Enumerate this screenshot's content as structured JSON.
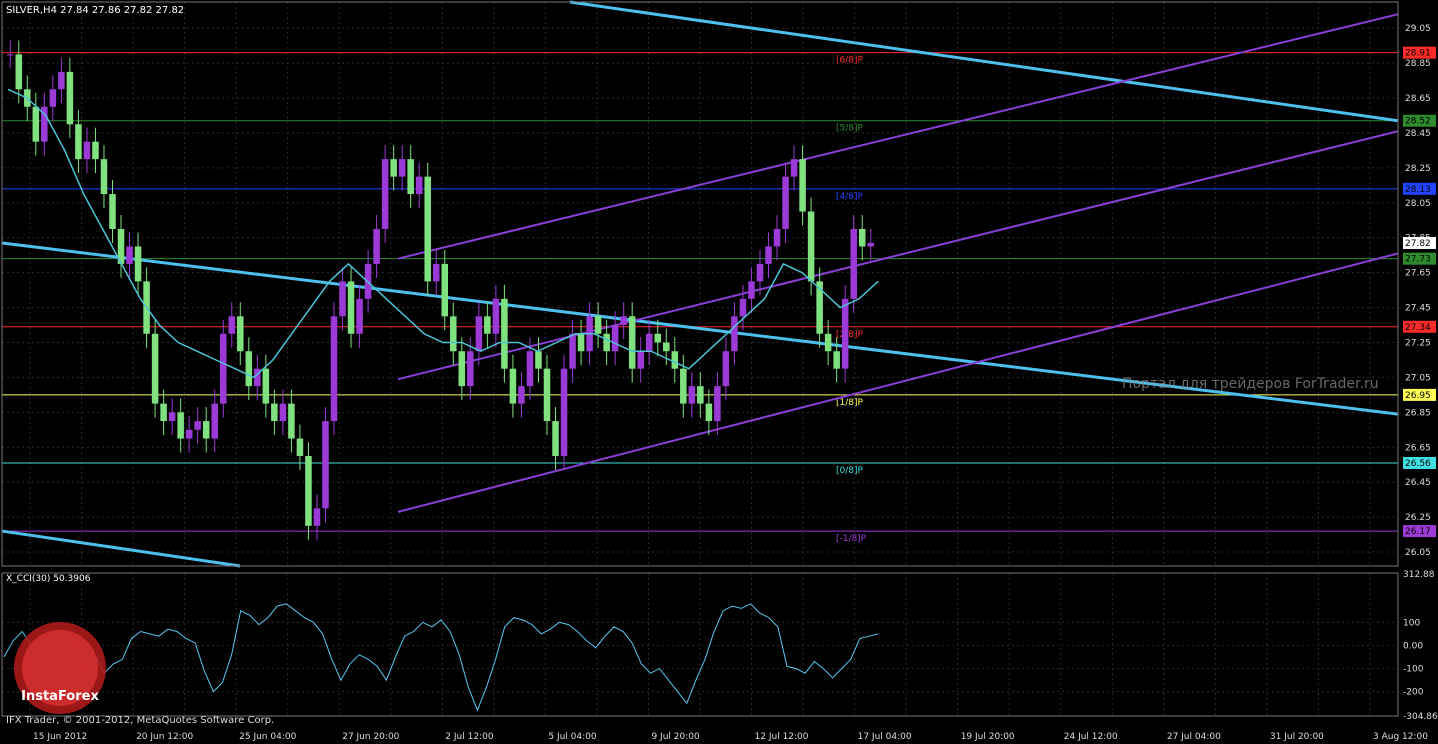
{
  "window": {
    "title": "SILVER,H4  27.84 27.86 27.82 27.82",
    "footer": "IFX Trader, © 2001-2012, MetaQuotes Software Corp.",
    "watermark": "Портал для трейдеров  ForTrader.ru",
    "logo_text": "InstaForex"
  },
  "colors": {
    "background": "#000000",
    "grid": "#2a2a2a",
    "bull": "#9b3ad6",
    "bear": "#7fe27f",
    "ma": "#4bc4d8",
    "trend_cyan": "#4cc0ee",
    "channel": "#8a3fd6",
    "cci": "#59c8f0"
  },
  "chart_data": [
    {
      "type": "candlestick",
      "symbol": "SILVER",
      "timeframe": "H4",
      "ohlc_last": {
        "open": 27.84,
        "high": 27.86,
        "low": 27.82,
        "close": 27.82
      },
      "ylim": [
        25.97,
        29.2
      ],
      "y_ticks": [
        "29.05",
        "28.85",
        "28.65",
        "28.45",
        "28.25",
        "28.05",
        "27.85",
        "27.65",
        "27.45",
        "27.25",
        "27.05",
        "26.85",
        "26.65",
        "26.45",
        "26.25",
        "26.05"
      ],
      "x_ticks": [
        "15 Jun 2012",
        "20 Jun 12:00",
        "25 Jun 04:00",
        "27 Jun 20:00",
        "2 Jul 12:00",
        "5 Jul 04:00",
        "9 Jul 20:00",
        "12 Jul 12:00",
        "17 Jul 04:00",
        "19 Jul 20:00",
        "24 Jul 12:00",
        "27 Jul 04:00",
        "31 Jul 20:00",
        "3 Aug 12:00"
      ],
      "current_price": "27.82",
      "murrey_levels": [
        {
          "label": "[6/8]P",
          "price": 28.91,
          "price_label": "28.91",
          "color": "#ff2a2a"
        },
        {
          "label": "[5/8]P",
          "price": 28.52,
          "price_label": "28.52",
          "color": "#2e8b2e"
        },
        {
          "label": "[4/8]P",
          "price": 28.13,
          "price_label": "28.13",
          "color": "#2244ff"
        },
        {
          "label": "",
          "price": 27.73,
          "price_label": "27.73",
          "color": "#2e8b2e"
        },
        {
          "label": "[2/8]P",
          "price": 27.34,
          "price_label": "27.34",
          "color": "#ff2a2a"
        },
        {
          "label": "[1/8]P",
          "price": 26.95,
          "price_label": "26.95",
          "color": "#ffff55"
        },
        {
          "label": "[0/8]P",
          "price": 26.56,
          "price_label": "26.56",
          "color": "#40e0e0"
        },
        {
          "label": "[-1/8]P",
          "price": 26.17,
          "price_label": "26.17",
          "color": "#9b3ad6"
        }
      ],
      "closes": [
        28.9,
        28.7,
        28.6,
        28.4,
        28.6,
        28.7,
        28.8,
        28.5,
        28.3,
        28.4,
        28.3,
        28.1,
        27.9,
        27.7,
        27.8,
        27.6,
        27.3,
        26.9,
        26.8,
        26.85,
        26.7,
        26.75,
        26.8,
        26.7,
        26.9,
        27.3,
        27.4,
        27.2,
        27.0,
        27.1,
        26.9,
        26.8,
        26.9,
        26.7,
        26.6,
        26.2,
        26.3,
        26.8,
        27.4,
        27.6,
        27.3,
        27.5,
        27.7,
        27.9,
        28.3,
        28.2,
        28.3,
        28.1,
        28.2,
        27.6,
        27.7,
        27.4,
        27.2,
        27.0,
        27.2,
        27.4,
        27.3,
        27.5,
        27.1,
        26.9,
        27.0,
        27.2,
        27.1,
        26.8,
        26.6,
        27.1,
        27.3,
        27.2,
        27.4,
        27.3,
        27.2,
        27.35,
        27.4,
        27.1,
        27.2,
        27.3,
        27.25,
        27.2,
        27.1,
        26.9,
        27.0,
        26.9,
        26.8,
        27.0,
        27.2,
        27.4,
        27.5,
        27.6,
        27.7,
        27.8,
        27.9,
        28.2,
        28.3,
        28.0,
        27.6,
        27.3,
        27.2,
        27.1,
        27.5,
        27.9,
        27.8,
        27.82
      ],
      "ma_values": [
        28.7,
        28.65,
        28.55,
        28.35,
        28.1,
        27.9,
        27.7,
        27.5,
        27.35,
        27.25,
        27.2,
        27.15,
        27.1,
        27.05,
        27.15,
        27.3,
        27.45,
        27.6,
        27.7,
        27.6,
        27.5,
        27.4,
        27.3,
        27.25,
        27.25,
        27.2,
        27.25,
        27.25,
        27.2,
        27.25,
        27.3,
        27.3,
        27.25,
        27.2,
        27.2,
        27.15,
        27.1,
        27.2,
        27.3,
        27.4,
        27.5,
        27.7,
        27.65,
        27.55,
        27.45,
        27.5,
        27.6
      ],
      "cci": {
        "label": "X_CCI(30) 50.3906",
        "ylim": [
          -304.86,
          312.88
        ],
        "y_ticks": [
          "312.88",
          "100",
          "0.00",
          "-100",
          "-200",
          "-304.86"
        ],
        "values": [
          -50,
          20,
          60,
          0,
          -100,
          -80,
          -30,
          10,
          20,
          -10,
          -40,
          -120,
          -80,
          -60,
          30,
          60,
          50,
          40,
          70,
          60,
          30,
          10,
          -110,
          -200,
          -160,
          -40,
          150,
          130,
          90,
          120,
          170,
          180,
          150,
          120,
          100,
          50,
          -60,
          -150,
          -80,
          -40,
          -60,
          -90,
          -150,
          -50,
          40,
          60,
          100,
          80,
          110,
          60,
          -40,
          -180,
          -280,
          -180,
          -60,
          80,
          120,
          110,
          90,
          50,
          70,
          100,
          90,
          60,
          20,
          -10,
          40,
          80,
          60,
          10,
          -80,
          -120,
          -100,
          -150,
          -200,
          -250,
          -150,
          -60,
          60,
          150,
          170,
          160,
          180,
          140,
          120,
          80,
          -90,
          -100,
          -120,
          -70,
          -100,
          -140,
          -100,
          -60,
          30,
          40,
          50
        ]
      }
    }
  ]
}
